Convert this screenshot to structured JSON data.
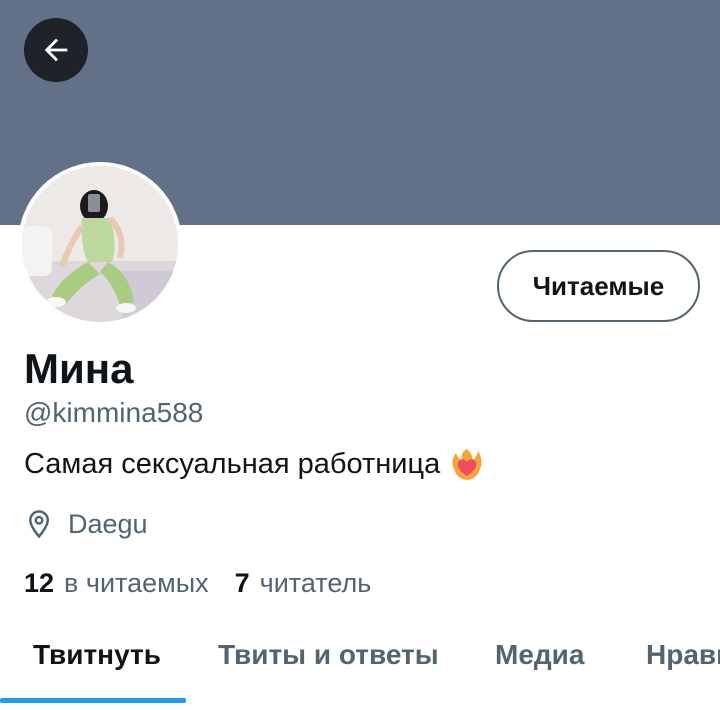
{
  "header": {
    "banner_color": "#627088",
    "back_icon": "arrow-left-icon"
  },
  "profile": {
    "display_name": "Мина",
    "handle": "@kimmina588",
    "bio": "Самая сексуальная работница",
    "bio_emoji": "heart-on-fire-icon",
    "location": "Daegu",
    "location_icon": "location-pin-icon",
    "follow_button_label": "Читаемые"
  },
  "stats": {
    "following_count": "12",
    "following_label": "в читаемых",
    "followers_count": "7",
    "followers_label": "читатель"
  },
  "tabs": [
    {
      "label": "Твитнуть",
      "active": true
    },
    {
      "label": "Твиты и ответы",
      "active": false
    },
    {
      "label": "Медиа",
      "active": false
    },
    {
      "label": "Нрави",
      "active": false
    }
  ],
  "colors": {
    "accent": "#1d9bf0",
    "primary_text": "#0f1419",
    "secondary_text": "#536471"
  }
}
